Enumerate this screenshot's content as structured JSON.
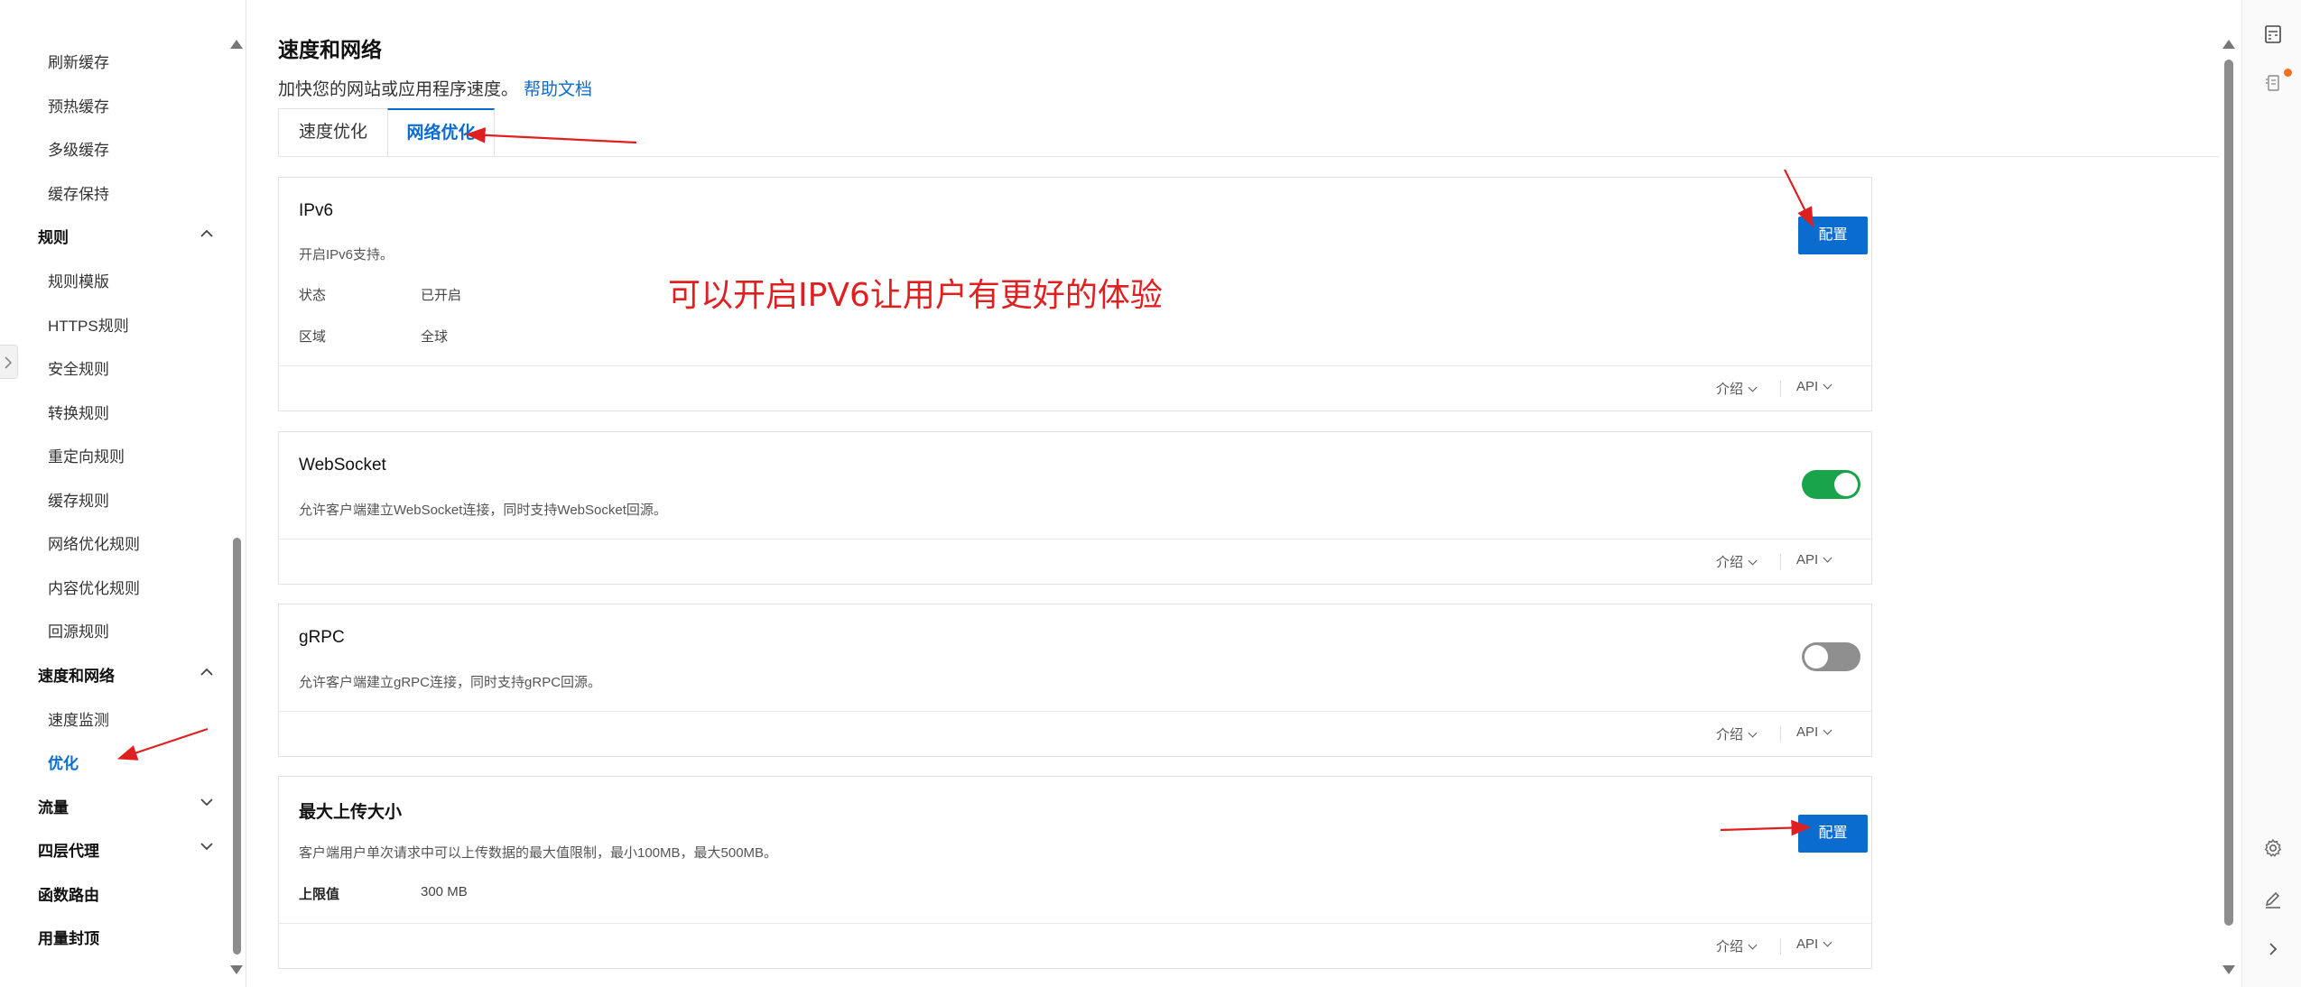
{
  "sidebar": {
    "items_top": [
      {
        "label": "刷新缓存"
      },
      {
        "label": "预热缓存"
      },
      {
        "label": "多级缓存"
      },
      {
        "label": "缓存保持"
      }
    ],
    "group_rules": {
      "label": "规则",
      "state": "expanded"
    },
    "rules_items": [
      {
        "label": "规则模版"
      },
      {
        "label": "HTTPS规则"
      },
      {
        "label": "安全规则"
      },
      {
        "label": "转换规则"
      },
      {
        "label": "重定向规则"
      },
      {
        "label": "缓存规则"
      },
      {
        "label": "网络优化规则"
      },
      {
        "label": "内容优化规则"
      },
      {
        "label": "回源规则"
      }
    ],
    "group_speed": {
      "label": "速度和网络",
      "state": "expanded"
    },
    "speed_items": [
      {
        "label": "速度监测"
      },
      {
        "label": "优化",
        "active": true
      }
    ],
    "group_traffic": {
      "label": "流量",
      "state": "collapsed"
    },
    "group_l4": {
      "label": "四层代理",
      "state": "collapsed"
    },
    "item_function_routing": {
      "label": "函数路由"
    },
    "item_usage_cap": {
      "label": "用量封顶"
    }
  },
  "header": {
    "title": "速度和网络",
    "description": "加快您的网站或应用程序速度。",
    "help_link": "帮助文档"
  },
  "tabs": [
    {
      "label": "速度优化",
      "active": false
    },
    {
      "label": "网络优化",
      "active": true
    }
  ],
  "cards": {
    "ipv6": {
      "title": "IPv6",
      "description": "开启IPv6支持。",
      "fields": [
        {
          "key": "状态",
          "value": "已开启"
        },
        {
          "key": "区域",
          "value": "全球"
        }
      ],
      "button": "配置",
      "footer": {
        "intro": "介绍",
        "api": "API"
      }
    },
    "websocket": {
      "title": "WebSocket",
      "description": "允许客户端建立WebSocket连接，同时支持WebSocket回源。",
      "toggle": "on",
      "footer": {
        "intro": "介绍",
        "api": "API"
      }
    },
    "grpc": {
      "title": "gRPC",
      "description": "允许客户端建立gRPC连接，同时支持gRPC回源。",
      "toggle": "off",
      "footer": {
        "intro": "介绍",
        "api": "API"
      }
    },
    "max_upload": {
      "title": "最大上传大小",
      "description": "客户端用户单次请求中可以上传数据的最大值限制，最小100MB，最大500MB。",
      "fields": [
        {
          "key": "上限值",
          "value": "300 MB"
        }
      ],
      "button": "配置",
      "footer": {
        "intro": "介绍",
        "api": "API"
      }
    }
  },
  "annotation": {
    "text": "可以开启IPV6让用户有更好的体验",
    "color": "#e02020"
  },
  "colors": {
    "accent": "#0a6ccf",
    "toggle_on": "#19a34b",
    "toggle_off": "#8f8f8f",
    "annotation_red": "#e02020",
    "notification_dot": "#f07020"
  },
  "rail_icons": [
    "calculator-icon",
    "document-list-icon",
    "settings-icon",
    "edit-icon",
    "chevron-right-icon"
  ]
}
